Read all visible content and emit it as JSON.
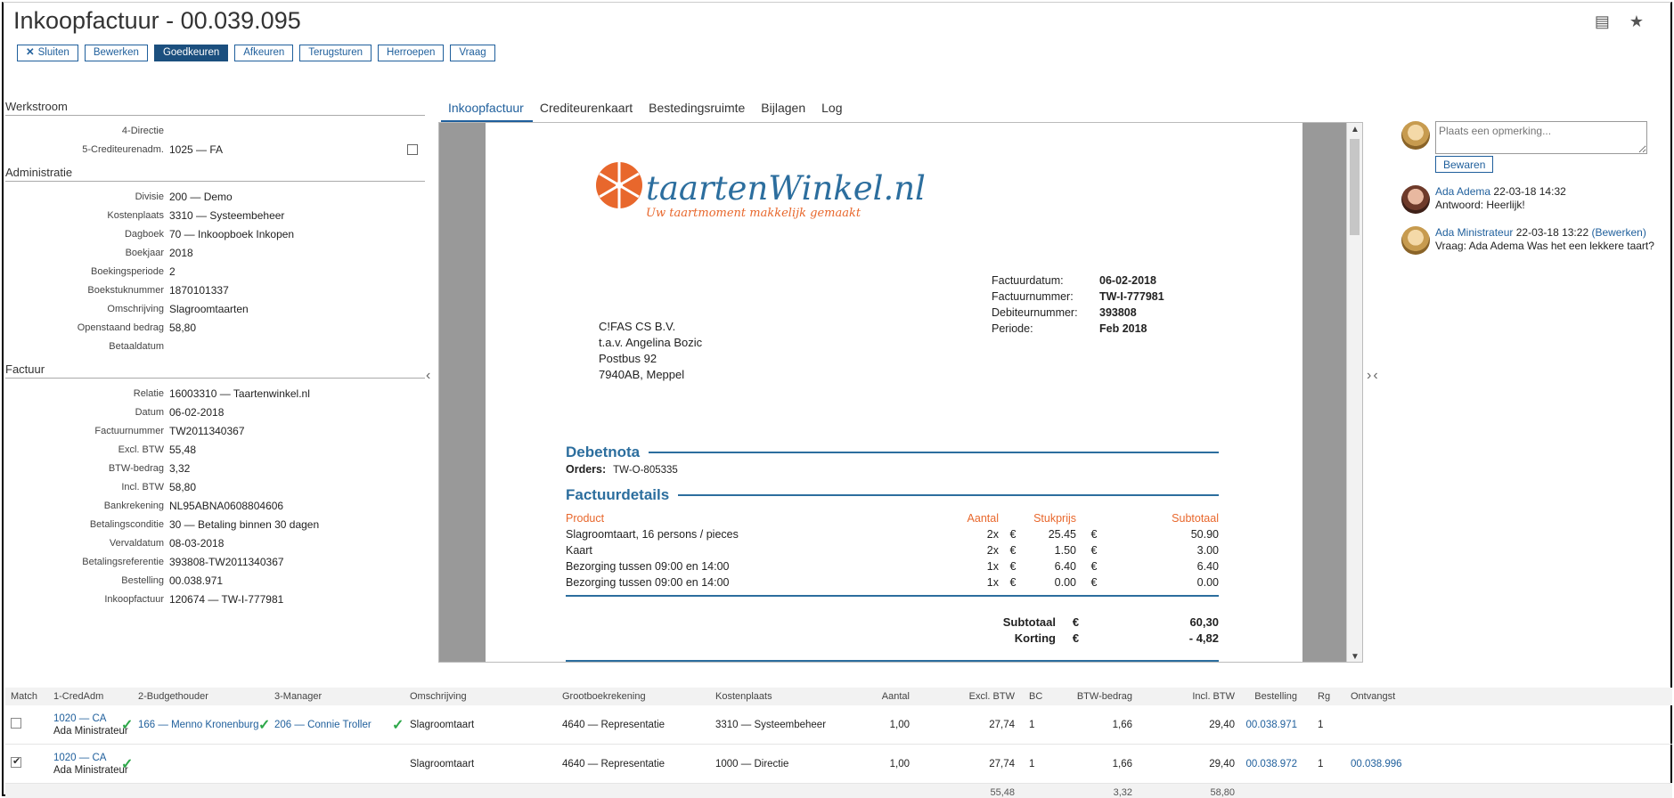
{
  "header": {
    "title": "Inkoopfactuur - 00.039.095",
    "buttons": {
      "sluiten": "Sluiten",
      "bewerken": "Bewerken",
      "goedkeuren": "Goedkeuren",
      "afkeuren": "Afkeuren",
      "terugsturen": "Terugsturen",
      "herroepen": "Herroepen",
      "vraag": "Vraag"
    },
    "icons": [
      "document-stack-icon",
      "star-icon"
    ]
  },
  "werkstroom": {
    "title": "Werkstroom",
    "step4_label": "4-Directie",
    "step5_label": "5-Crediteurenadm.",
    "step5_value": "1025 — FA"
  },
  "administratie": {
    "title": "Administratie",
    "rows": [
      {
        "label": "Divisie",
        "value": "200 — Demo"
      },
      {
        "label": "Kostenplaats",
        "value": "3310 — Systeembeheer"
      },
      {
        "label": "Dagboek",
        "value": "70 — Inkoopboek Inkopen"
      },
      {
        "label": "Boekjaar",
        "value": "2018"
      },
      {
        "label": "Boekingsperiode",
        "value": "2"
      },
      {
        "label": "Boekstuknummer",
        "value": "1870101337"
      },
      {
        "label": "Omschrijving",
        "value": "Slagroomtaarten"
      },
      {
        "label": "Openstaand bedrag",
        "value": "58,80"
      },
      {
        "label": "Betaaldatum",
        "value": ""
      }
    ]
  },
  "factuur": {
    "title": "Factuur",
    "rows": [
      {
        "label": "Relatie",
        "value": "16003310 — Taartenwinkel.nl"
      },
      {
        "label": "Datum",
        "value": "06-02-2018"
      },
      {
        "label": "Factuurnummer",
        "value": "TW2011340367"
      },
      {
        "label": "Excl. BTW",
        "value": "55,48"
      },
      {
        "label": "BTW-bedrag",
        "value": "3,32"
      },
      {
        "label": "Incl. BTW",
        "value": "58,80"
      },
      {
        "label": "Bankrekening",
        "value": "NL95ABNA0608804606"
      },
      {
        "label": "Betalingsconditie",
        "value": "30 — Betaling binnen 30 dagen"
      },
      {
        "label": "Vervaldatum",
        "value": "08-03-2018"
      },
      {
        "label": "Betalingsreferentie",
        "value": "393808-TW2011340367"
      },
      {
        "label": "Bestelling",
        "value": "00.038.971"
      },
      {
        "label": "Inkoopfactuur",
        "value": "120674 — TW-I-777981"
      }
    ]
  },
  "tabs": [
    "Inkoopfactuur",
    "Crediteurenkaart",
    "Bestedingsruimte",
    "Bijlagen",
    "Log"
  ],
  "invoice": {
    "logo_word": "taartenWinkel.nl",
    "logo_tagline": "Uw taartmoment makkelijk gemaakt",
    "meta": [
      {
        "k": "Factuurdatum:",
        "v": "06-02-2018"
      },
      {
        "k": "Factuurnummer:",
        "v": "TW-I-777981"
      },
      {
        "k": "Debiteurnummer:",
        "v": "393808"
      },
      {
        "k": "Periode:",
        "v": "Feb 2018"
      }
    ],
    "address": [
      "C!FAS CS B.V.",
      "t.a.v. Angelina Bozic",
      "Postbus 92",
      "7940AB, Meppel"
    ],
    "debetnota_title": "Debetnota",
    "orders_label": "Orders:",
    "orders_value": "TW-O-805335",
    "details_title": "Factuurdetails",
    "columns": {
      "product": "Product",
      "aantal": "Aantal",
      "stukprijs": "Stukprijs",
      "subtotaal": "Subtotaal"
    },
    "currency": "€",
    "items": [
      {
        "product": "Slagroomtaart, 16 persons / pieces",
        "qty": "2x",
        "price": "25.45",
        "sub": "50.90"
      },
      {
        "product": "Kaart",
        "qty": "2x",
        "price": "1.50",
        "sub": "3.00"
      },
      {
        "product": "Bezorging tussen 09:00 en 14:00",
        "qty": "1x",
        "price": "6.40",
        "sub": "6.40"
      },
      {
        "product": "Bezorging tussen 09:00 en 14:00",
        "qty": "1x",
        "price": "0.00",
        "sub": "0.00"
      }
    ],
    "totals": [
      {
        "k": "Subtotaal",
        "v": "60,30"
      },
      {
        "k": "Korting",
        "v": "- 4,82"
      }
    ]
  },
  "comments": {
    "placeholder": "Plaats een opmerking...",
    "save_label": "Bewaren",
    "items": [
      {
        "author": "Ada Adema",
        "when": "22-03-18 14:32",
        "edit": "",
        "text": "Antwoord: Heerlijk!"
      },
      {
        "author": "Ada Ministrateur",
        "when": "22-03-18 13:22",
        "edit": "(Bewerken)",
        "text": "Vraag: Ada Adema Was het een lekkere taart?"
      }
    ]
  },
  "grid": {
    "headers": [
      "Match",
      "1-CredAdm",
      "2-Budgethouder",
      "3-Manager",
      "Omschrijving",
      "Grootboekrekening",
      "Kostenplaats",
      "Aantal",
      "Excl. BTW",
      "BC",
      "BTW-bedrag",
      "Incl. BTW",
      "Bestelling",
      "Rg",
      "Ontvangst"
    ],
    "rows": [
      {
        "match": false,
        "cred_code": "1020 — CA",
        "cred_name": "Ada Ministrateur",
        "budget": "166 — Menno Kronenburg",
        "manager": "206 — Connie Troller",
        "omschrijving": "Slagroomtaart",
        "grootboek": "4640 — Representatie",
        "kostenplaats": "3310 — Systeembeheer",
        "aantal": "1,00",
        "excl": "27,74",
        "bc": "1",
        "btw": "1,66",
        "incl": "29,40",
        "bestelling": "00.038.971",
        "rg": "1",
        "ontvangst": ""
      },
      {
        "match": true,
        "cred_code": "1020 — CA",
        "cred_name": "Ada Ministrateur",
        "budget": "",
        "manager": "",
        "omschrijving": "Slagroomtaart",
        "grootboek": "4640 — Representatie",
        "kostenplaats": "1000 — Directie",
        "aantal": "1,00",
        "excl": "27,74",
        "bc": "1",
        "btw": "1,66",
        "incl": "29,40",
        "bestelling": "00.038.972",
        "rg": "1",
        "ontvangst": "00.038.996"
      }
    ],
    "totals": {
      "excl": "55,48",
      "btw": "3,32",
      "incl": "58,80"
    }
  },
  "colors": {
    "link": "#1f5f9c",
    "primary": "#1b4f7e",
    "accent_orange": "#e8672c",
    "invoice_blue": "#2c6e9e",
    "check_green": "#2ea84a"
  }
}
